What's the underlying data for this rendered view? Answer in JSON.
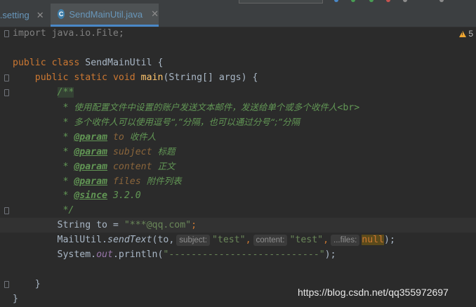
{
  "tabs": [
    {
      "label": "il.setting",
      "active": false
    },
    {
      "label": "SendMainUtil.java",
      "active": true,
      "icon": "java-class-icon"
    }
  ],
  "status": {
    "warning_count": "5",
    "warning_icon": "warning-icon"
  },
  "code": {
    "l1": "import java.io.File;",
    "l3_kw1": "public",
    "l3_kw2": "class",
    "l3_name": "SendMainUtil",
    "l3_brace": "{",
    "l4_kw1": "public",
    "l4_kw2": "static",
    "l4_kw3": "void",
    "l4_fn": "main",
    "l4_rest": "(String[] args)",
    "l4_brace": "{",
    "l5": "/**",
    "l6_star": " * ",
    "l6_text": "使用配置文件中设置的账户发送文本邮件，发送给单个或多个收件人",
    "l6_br": "<br>",
    "l7_text": "多个收件人可以使用逗号“,”分隔，也可以通过分号“;”分隔",
    "l8_tag": "@param",
    "l8_name": "to",
    "l8_text": "收件人",
    "l9_tag": "@param",
    "l9_name": "subject",
    "l9_text": "标题",
    "l10_tag": "@param",
    "l10_name": "content",
    "l10_text": "正文",
    "l11_tag": "@param",
    "l11_name": "files",
    "l11_text": "附件列表",
    "l12_tag": "@since",
    "l12_text": "3.2.0",
    "l13": " */",
    "l14_type": "String to = ",
    "l14_str": "\"***@qq.com\"",
    "l14_end": ";",
    "l15_a": "MailUtil.",
    "l15_fn": "sendText",
    "l15_b": "(to,",
    "l15_hint1": "subject:",
    "l15_s1": "\"test\"",
    "l15_c1": ",",
    "l15_hint2": "content:",
    "l15_s2": "\"test\"",
    "l15_c2": ",",
    "l15_hint3": "...files:",
    "l15_null": "null",
    "l15_end": ");",
    "l16_a": "System.",
    "l16_out": "out",
    "l16_b": ".println(",
    "l16_str": "\"---------------------------\"",
    "l16_end": ");",
    "l18": "}",
    "l19": "}"
  },
  "watermark": "https://blog.csdn.net/qq355972697"
}
